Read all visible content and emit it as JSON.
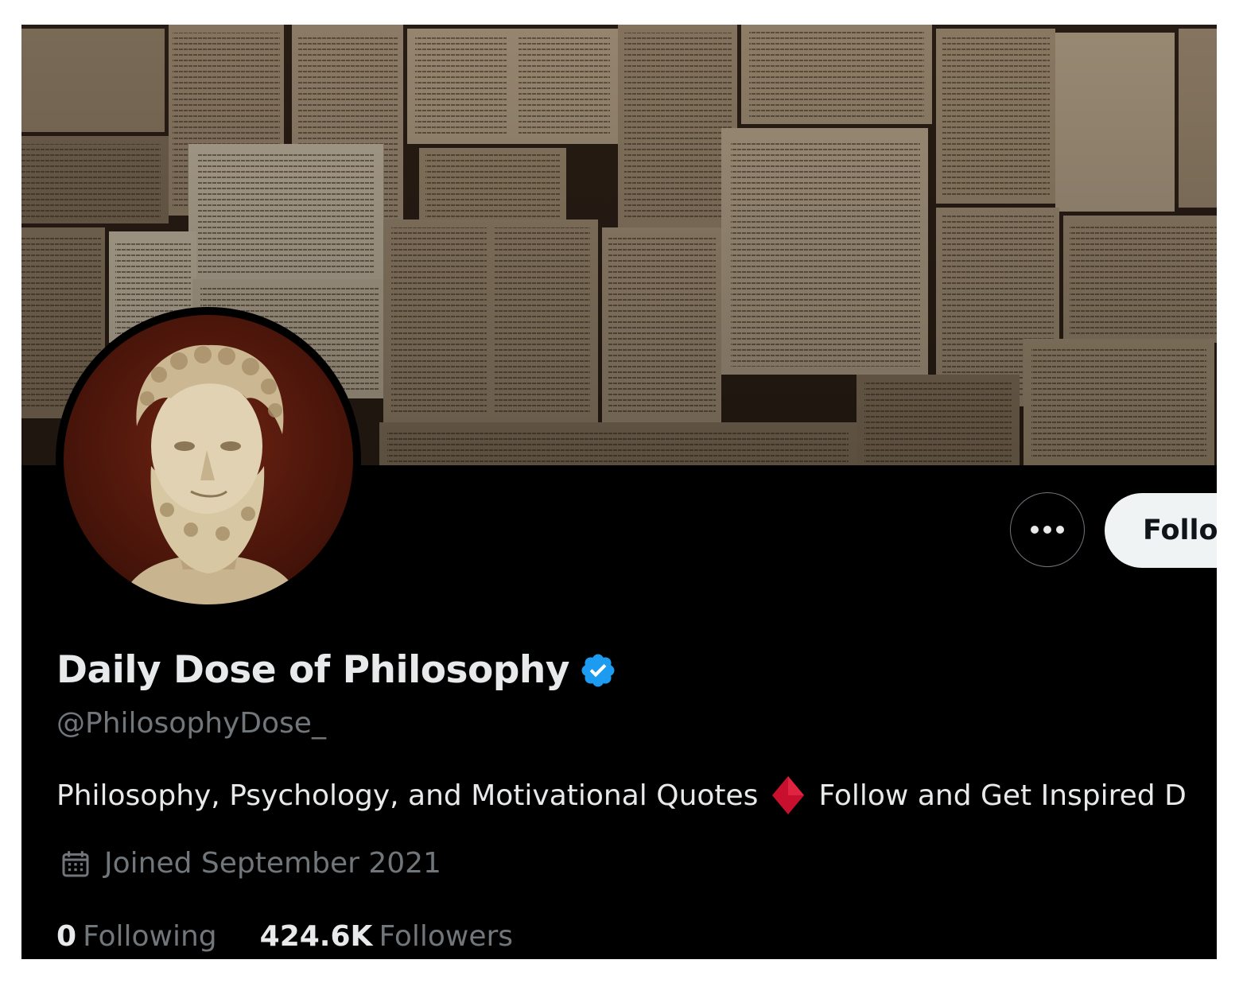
{
  "profile": {
    "display_name": "Daily Dose of Philosophy",
    "handle": "@PhilosophyDose_",
    "bio_part1": "Philosophy, Psychology, and Motivational Quotes",
    "bio_part2": "Follow and Get Inspired D",
    "joined": "Joined September 2021",
    "verified": true
  },
  "actions": {
    "follow_label": "Follo"
  },
  "stats": {
    "following_count": "0",
    "following_label": "Following",
    "followers_count": "424.6K",
    "followers_label": "Followers"
  },
  "icons": {
    "more": "more-horizontal-icon",
    "verified": "verified-badge-icon",
    "calendar": "calendar-icon",
    "bio_emoji": "red-diamond-icon"
  },
  "colors": {
    "background": "#000000",
    "primary_text": "#e7e9ea",
    "secondary_text": "#71767b",
    "verified_blue": "#1d9bf0",
    "follow_button_bg": "#eff3f4",
    "diamond_red": "#c8102e"
  }
}
